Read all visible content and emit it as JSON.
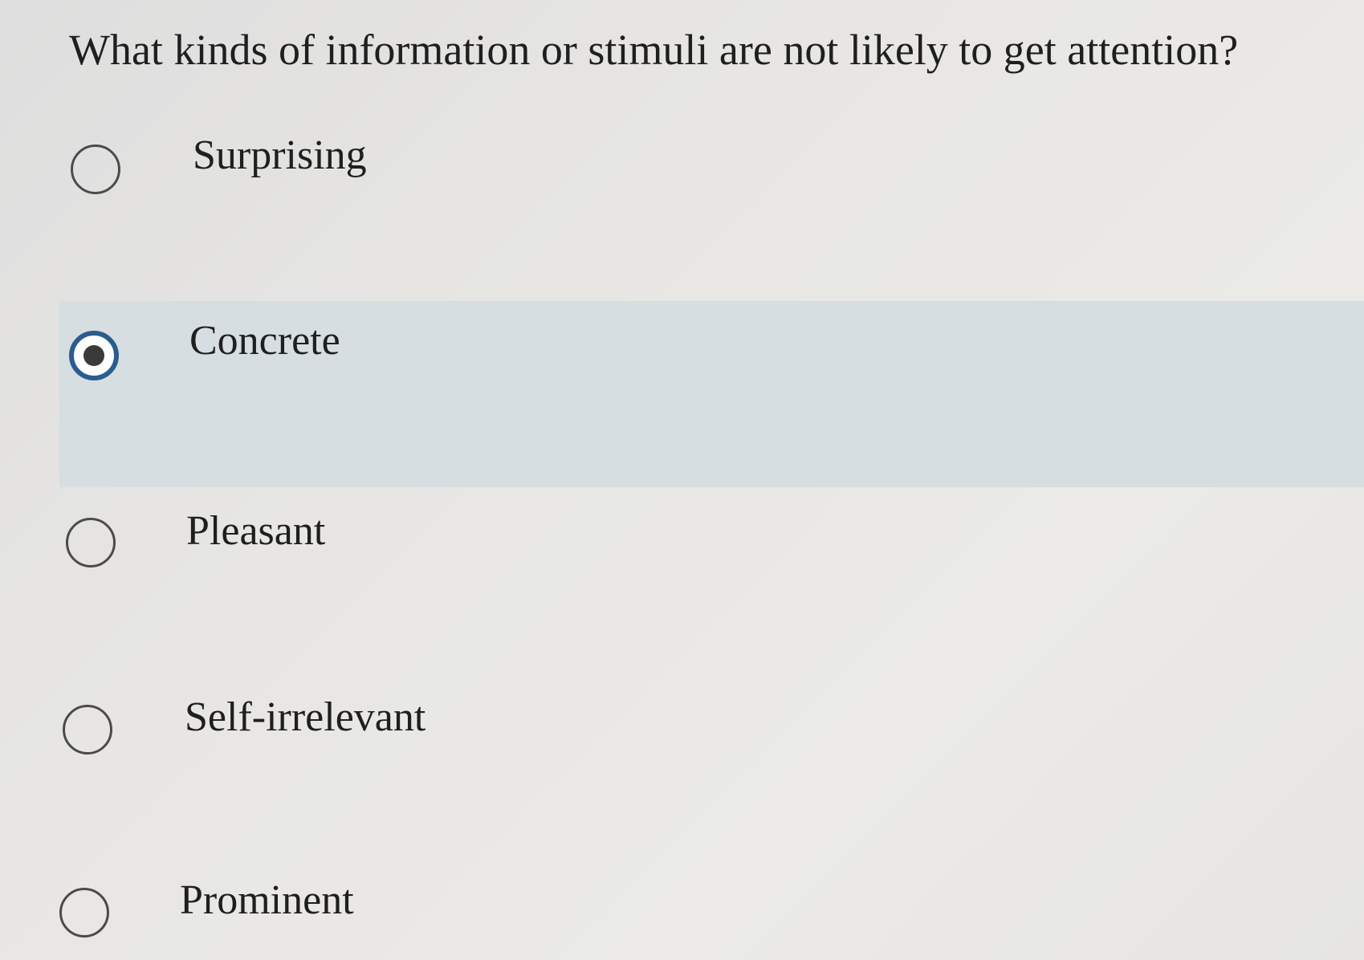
{
  "question": {
    "text": "What kinds of information or stimuli are not likely to get attention?"
  },
  "options": [
    {
      "label": "Surprising",
      "selected": false
    },
    {
      "label": "Concrete",
      "selected": true
    },
    {
      "label": "Pleasant",
      "selected": false
    },
    {
      "label": "Self-irrelevant",
      "selected": false
    },
    {
      "label": "Prominent",
      "selected": false
    }
  ],
  "colors": {
    "selected_row_background": "#d6dee2",
    "selected_radio_ring": "#2a5d8f",
    "radio_border": "#4b4b4b",
    "text": "#1f1f1f"
  }
}
